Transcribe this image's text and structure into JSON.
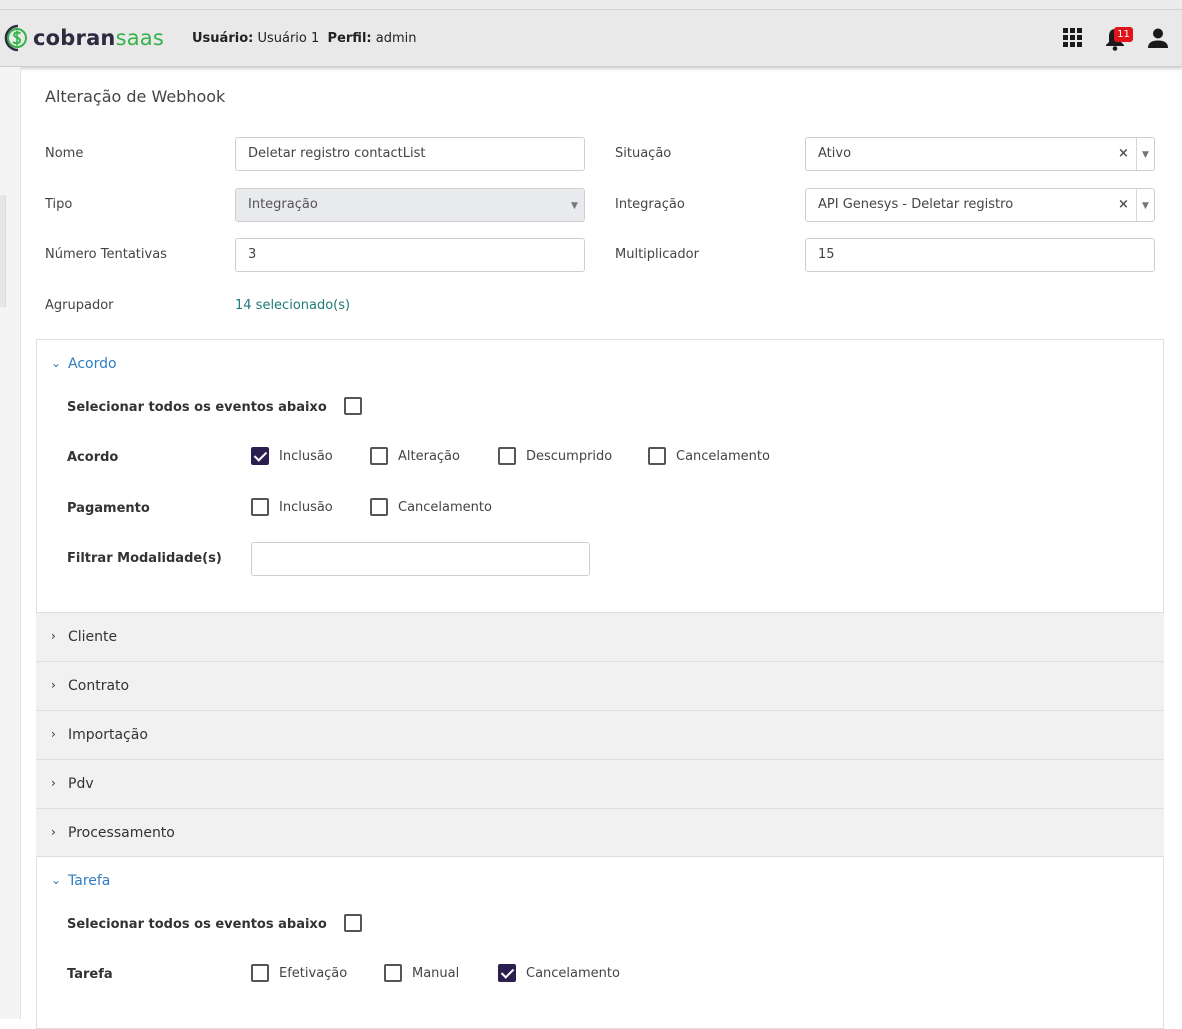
{
  "header": {
    "logo": {
      "part1": "cobran",
      "part2": "saas"
    },
    "user_label": "Usuário:",
    "user_value": "Usuário 1",
    "profile_label": "Perfil:",
    "profile_value": "admin",
    "apps_icon": "grid-icon",
    "notifications_icon": "bell-icon",
    "notifications_count": "11",
    "account_icon": "person-icon",
    "badge_color": "#e0131a"
  },
  "page": {
    "title": "Alteração de Webhook"
  },
  "form": {
    "nome": {
      "label": "Nome",
      "value": "Deletar registro contactList"
    },
    "situacao": {
      "label": "Situação",
      "value": "Ativo"
    },
    "tipo": {
      "label": "Tipo",
      "value": "Integração"
    },
    "integracao": {
      "label": "Integração",
      "value": "API Genesys - Deletar registro"
    },
    "tentativas": {
      "label": "Número Tentativas",
      "value": "3"
    },
    "multiplicador": {
      "label": "Multiplicador",
      "value": "15"
    },
    "agrupador": {
      "label": "Agrupador",
      "value": "14 selecionado(s)"
    }
  },
  "sections": {
    "acordo": {
      "title": "Acordo",
      "select_all_label": "Selecionar todos os eventos abaixo",
      "select_all_checked": false,
      "rows": [
        {
          "label": "Acordo",
          "options": [
            {
              "label": "Inclusão",
              "checked": true
            },
            {
              "label": "Alteração",
              "checked": false
            },
            {
              "label": "Descumprido",
              "checked": false
            },
            {
              "label": "Cancelamento",
              "checked": false
            }
          ]
        },
        {
          "label": "Pagamento",
          "options": [
            {
              "label": "Inclusão",
              "checked": false
            },
            {
              "label": "Cancelamento",
              "checked": false
            }
          ]
        }
      ],
      "filter_label": "Filtrar Modalidade(s)",
      "filter_value": ""
    },
    "collapsed": [
      "Cliente",
      "Contrato",
      "Importação",
      "Pdv",
      "Processamento"
    ],
    "tarefa": {
      "title": "Tarefa",
      "select_all_label": "Selecionar todos os eventos abaixo",
      "select_all_checked": false,
      "rows": [
        {
          "label": "Tarefa",
          "options": [
            {
              "label": "Efetivação",
              "checked": false
            },
            {
              "label": "Manual",
              "checked": false
            },
            {
              "label": "Cancelamento",
              "checked": true
            }
          ]
        }
      ]
    }
  },
  "colors": {
    "accent": "#2f7dc2",
    "checkbox_checked": "#2a1f4f",
    "link": "#1f7a7a",
    "logo_dark": "#2e2a3f",
    "logo_green": "#35b34a"
  }
}
